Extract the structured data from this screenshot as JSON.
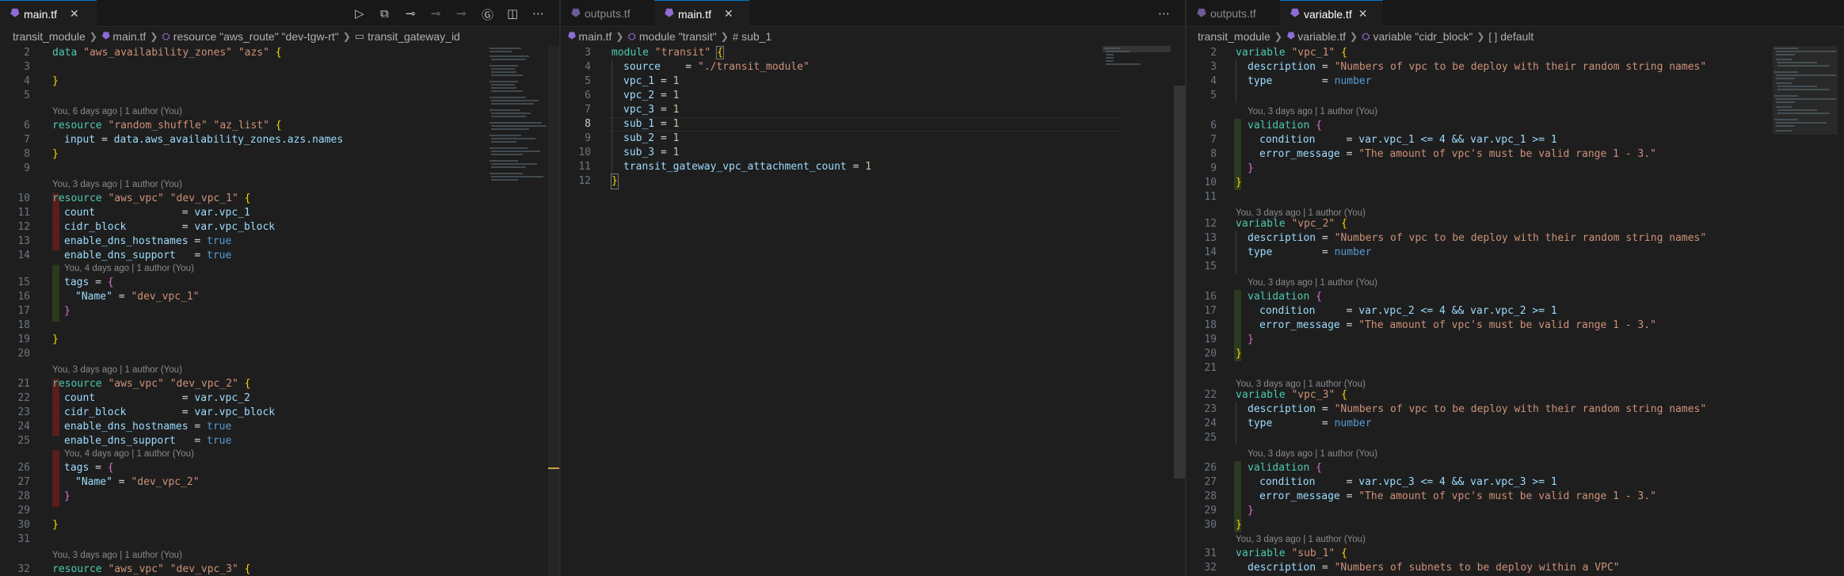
{
  "tabs": {
    "left": [
      {
        "label": "main.tf",
        "active": true
      }
    ],
    "middle": [
      {
        "label": "outputs.tf",
        "active": false
      },
      {
        "label": "main.tf",
        "active": true
      }
    ],
    "right": [
      {
        "label": "outputs.tf",
        "active": false
      },
      {
        "label": "variable.tf",
        "active": true
      }
    ]
  },
  "toolbar_icons": [
    "run-icon",
    "split-diff-icon",
    "git-commit-icon",
    "git-prev-icon",
    "git-next-icon",
    "git-branch-icon",
    "split-editor-icon",
    "more-icon"
  ],
  "breadcrumbs": {
    "left": [
      "transit_module",
      "main.tf",
      "resource \"aws_route\" \"dev-tgw-rt\"",
      "transit_gateway_id"
    ],
    "middle": [
      "main.tf",
      "module \"transit\"",
      "sub_1"
    ],
    "right": [
      "transit_module",
      "variable.tf",
      "variable \"cidr_block\"",
      "default"
    ]
  },
  "lens": {
    "six_days": "You, 6 days ago | 1 author (You)",
    "three_days": "You, 3 days ago | 1 author (You)",
    "four_days": "You, 4 days ago | 1 author (You)"
  },
  "code": {
    "left": {
      "l2": {
        "n": "2",
        "a": "data",
        "b": "\"aws_availability_zones\"",
        "c": "\"azs\"",
        "d": "{"
      },
      "l3": {
        "n": "3"
      },
      "l4": {
        "n": "4",
        "a": "}"
      },
      "l5": {
        "n": "5"
      },
      "l6": {
        "n": "6",
        "a": "resource",
        "b": "\"random_shuffle\"",
        "c": "\"az_list\"",
        "d": "{"
      },
      "l7": {
        "n": "7",
        "a": "input",
        "b": " = ",
        "c": "data.aws_availability_zones.azs.names"
      },
      "l8": {
        "n": "8",
        "a": "}"
      },
      "l9": {
        "n": "9"
      },
      "l10": {
        "n": "10",
        "a": "resource",
        "b": "\"aws_vpc\"",
        "c": "\"dev_vpc_1\"",
        "d": "{"
      },
      "l11": {
        "n": "11",
        "a": "count",
        "b": "              = ",
        "c": "var.vpc_1"
      },
      "l12": {
        "n": "12",
        "a": "cidr_block",
        "b": "         = ",
        "c": "var.vpc_block"
      },
      "l13": {
        "n": "13",
        "a": "enable_dns_hostnames",
        "b": " = ",
        "c": "true"
      },
      "l14": {
        "n": "14",
        "a": "enable_dns_support",
        "b": "   = ",
        "c": "true"
      },
      "l15": {
        "n": "15",
        "a": "tags",
        "b": " = ",
        "c": "{"
      },
      "l16": {
        "n": "16",
        "a": "\"Name\"",
        "b": " = ",
        "c": "\"dev_vpc_1\""
      },
      "l17": {
        "n": "17",
        "a": "}"
      },
      "l18": {
        "n": "18"
      },
      "l19": {
        "n": "19",
        "a": "}"
      },
      "l20": {
        "n": "20"
      },
      "l21": {
        "n": "21",
        "a": "resource",
        "b": "\"aws_vpc\"",
        "c": "\"dev_vpc_2\"",
        "d": "{"
      },
      "l22": {
        "n": "22",
        "a": "count",
        "b": "              = ",
        "c": "var.vpc_2"
      },
      "l23": {
        "n": "23",
        "a": "cidr_block",
        "b": "         = ",
        "c": "var.vpc_block"
      },
      "l24": {
        "n": "24",
        "a": "enable_dns_hostnames",
        "b": " = ",
        "c": "true"
      },
      "l25": {
        "n": "25",
        "a": "enable_dns_support",
        "b": "   = ",
        "c": "true"
      },
      "l26": {
        "n": "26",
        "a": "tags",
        "b": " = ",
        "c": "{"
      },
      "l27": {
        "n": "27",
        "a": "\"Name\"",
        "b": " = ",
        "c": "\"dev_vpc_2\""
      },
      "l28": {
        "n": "28",
        "a": "}"
      },
      "l29": {
        "n": "29"
      },
      "l30": {
        "n": "30",
        "a": "}"
      },
      "l31": {
        "n": "31"
      },
      "l32": {
        "n": "32",
        "a": "resource",
        "b": "\"aws_vpc\"",
        "c": "\"dev_vpc_3\"",
        "d": "{"
      }
    },
    "middle": {
      "l3": {
        "n": "3",
        "a": "module",
        "b": "\"transit\"",
        "c": "{"
      },
      "l4": {
        "n": "4",
        "a": "source",
        "b": "    = ",
        "c": "\"./transit_module\""
      },
      "l5": {
        "n": "5",
        "a": "vpc_1",
        "b": " = ",
        "c": "1"
      },
      "l6": {
        "n": "6",
        "a": "vpc_2",
        "b": " = ",
        "c": "1"
      },
      "l7": {
        "n": "7",
        "a": "vpc_3",
        "b": " = ",
        "c": "1"
      },
      "l8": {
        "n": "8",
        "a": "sub_1",
        "b": " = ",
        "c": "1"
      },
      "l9": {
        "n": "9",
        "a": "sub_2",
        "b": " = ",
        "c": "1"
      },
      "l10": {
        "n": "10",
        "a": "sub_3",
        "b": " = ",
        "c": "1"
      },
      "l11": {
        "n": "11",
        "a": "transit_gateway_vpc_attachment_count",
        "b": " = ",
        "c": "1"
      },
      "l12": {
        "n": "12",
        "a": "}"
      }
    },
    "right": {
      "l2": {
        "n": "2",
        "a": "variable",
        "b": "\"vpc_1\"",
        "c": "{"
      },
      "l3": {
        "n": "3",
        "a": "description",
        "b": " = ",
        "c": "\"Numbers of vpc to be deploy with their random string names\""
      },
      "l4": {
        "n": "4",
        "a": "type",
        "b": "        = ",
        "c": "number"
      },
      "l5": {
        "n": "5"
      },
      "l6": {
        "n": "6",
        "a": "validation",
        "b": " {"
      },
      "l7": {
        "n": "7",
        "a": "condition",
        "b": "     = ",
        "c": "var.vpc_1 <= 4 && var.vpc_1 >= 1"
      },
      "l8": {
        "n": "8",
        "a": "error_message",
        "b": " = ",
        "c": "\"The amount of vpc's must be valid range 1 - 3.\""
      },
      "l9": {
        "n": "9",
        "a": "}"
      },
      "l10": {
        "n": "10",
        "a": "}"
      },
      "l11": {
        "n": "11"
      },
      "l12": {
        "n": "12",
        "a": "variable",
        "b": "\"vpc_2\"",
        "c": "{"
      },
      "l13": {
        "n": "13",
        "a": "description",
        "b": " = ",
        "c": "\"Numbers of vpc to be deploy with their random string names\""
      },
      "l14": {
        "n": "14",
        "a": "type",
        "b": "        = ",
        "c": "number"
      },
      "l15": {
        "n": "15"
      },
      "l16": {
        "n": "16",
        "a": "validation",
        "b": " {"
      },
      "l17": {
        "n": "17",
        "a": "condition",
        "b": "     = ",
        "c": "var.vpc_2 <= 4 && var.vpc_2 >= 1"
      },
      "l18": {
        "n": "18",
        "a": "error_message",
        "b": " = ",
        "c": "\"The amount of vpc's must be valid range 1 - 3.\""
      },
      "l19": {
        "n": "19",
        "a": "}"
      },
      "l20": {
        "n": "20",
        "a": "}"
      },
      "l21": {
        "n": "21"
      },
      "l22": {
        "n": "22",
        "a": "variable",
        "b": "\"vpc_3\"",
        "c": "{"
      },
      "l23": {
        "n": "23",
        "a": "description",
        "b": " = ",
        "c": "\"Numbers of vpc to be deploy with their random string names\""
      },
      "l24": {
        "n": "24",
        "a": "type",
        "b": "        = ",
        "c": "number"
      },
      "l25": {
        "n": "25"
      },
      "l26": {
        "n": "26",
        "a": "validation",
        "b": " {"
      },
      "l27": {
        "n": "27",
        "a": "condition",
        "b": "     = ",
        "c": "var.vpc_3 <= 4 && var.vpc_3 >= 1"
      },
      "l28": {
        "n": "28",
        "a": "error_message",
        "b": " = ",
        "c": "\"The amount of vpc's must be valid range 1 - 3.\""
      },
      "l29": {
        "n": "29",
        "a": "}"
      },
      "l30": {
        "n": "30",
        "a": "}"
      },
      "l31": {
        "n": "31",
        "a": "variable",
        "b": "\"sub_1\"",
        "c": "{"
      },
      "l32": {
        "n": "32",
        "a": "description",
        "b": " = ",
        "c": "\"Numbers of subnets to be deploy within a VPC\""
      }
    }
  }
}
